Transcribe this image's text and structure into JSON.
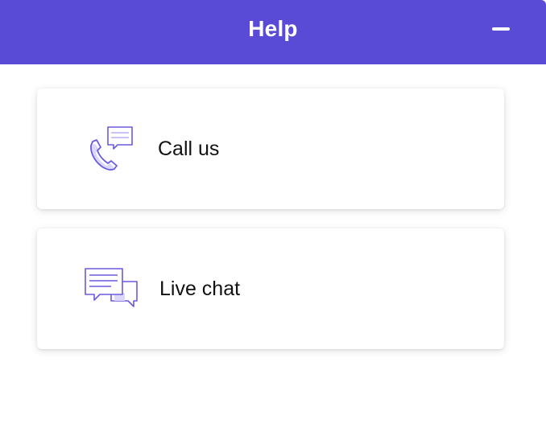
{
  "header": {
    "title": "Help",
    "minimize_icon": "minimize-icon"
  },
  "options": [
    {
      "label": "Call us",
      "icon": "phone-chat-icon"
    },
    {
      "label": "Live chat",
      "icon": "chat-bubbles-icon"
    }
  ],
  "colors": {
    "header_bg": "#5a4bd6",
    "icon_stroke": "#6a5ae0",
    "icon_fill": "#ddd8fb"
  }
}
